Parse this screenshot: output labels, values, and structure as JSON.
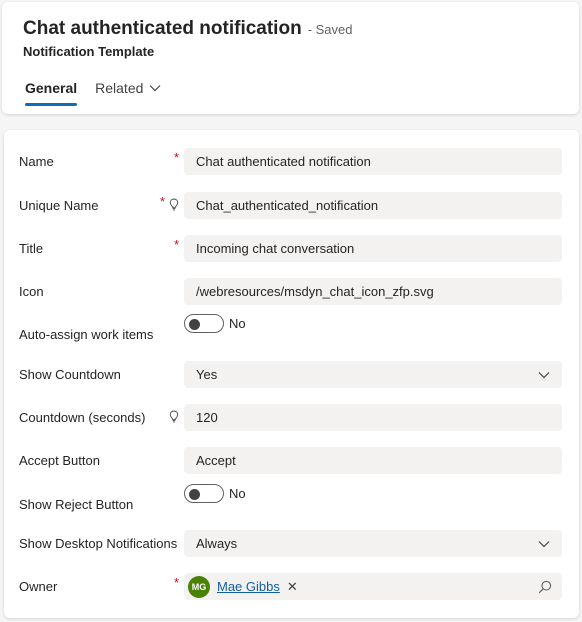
{
  "header": {
    "title": "Chat authenticated notification",
    "status": "- Saved",
    "subtitle": "Notification Template",
    "tabs": [
      {
        "label": "General",
        "active": true
      },
      {
        "label": "Related",
        "active": false,
        "icon": "chevron-down-icon"
      }
    ]
  },
  "form": {
    "name": {
      "label": "Name",
      "required": "*",
      "value": "Chat authenticated notification"
    },
    "unique_name": {
      "label": "Unique Name",
      "required": "*",
      "value": "Chat_authenticated_notification",
      "icon": "lightbulb-icon"
    },
    "title": {
      "label": "Title",
      "required": "*",
      "value": "Incoming chat conversation"
    },
    "icon": {
      "label": "Icon",
      "value": "/webresources/msdyn_chat_icon_zfp.svg"
    },
    "auto_assign": {
      "label": "Auto-assign work items",
      "value": "No",
      "on": false
    },
    "show_countdown": {
      "label": "Show Countdown",
      "value": "Yes",
      "icon": "chevron-down-icon"
    },
    "countdown_seconds": {
      "label": "Countdown (seconds)",
      "value": "120",
      "icon": "lightbulb-icon"
    },
    "accept_button": {
      "label": "Accept Button",
      "value": "Accept"
    },
    "show_reject": {
      "label": "Show Reject Button",
      "value": "No",
      "on": false
    },
    "show_desktop": {
      "label": "Show Desktop Notifications",
      "value": "Always",
      "icon": "chevron-down-icon"
    },
    "owner": {
      "label": "Owner",
      "required": "*",
      "initials": "MG",
      "name": "Mae Gibbs",
      "remove": "✕",
      "icon": "search-icon"
    }
  },
  "colors": {
    "accent": "#0f6cbd",
    "required": "#c50f1f",
    "avatar": "#498205",
    "link": "#115ea3",
    "field_bg": "#f3f2f1"
  }
}
